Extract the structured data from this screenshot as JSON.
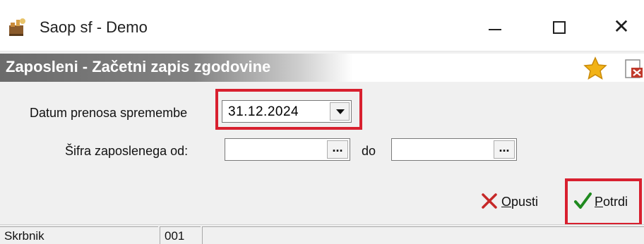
{
  "window": {
    "title": "Saop sf - Demo",
    "controls": {
      "minimize": "minimize",
      "maximize": "maximize",
      "close": "✕"
    }
  },
  "heading": {
    "title": "Zaposleni - Začetni zapis zgodovine",
    "icons": [
      "star-icon",
      "document-delete-icon"
    ]
  },
  "form": {
    "date_label": "Datum prenosa spremembe",
    "date_value": "31.12.2024",
    "code_label": "Šifra zaposlenega od:",
    "code_from": "",
    "to_label": "do",
    "code_to": "",
    "ellipsis": "..."
  },
  "actions": {
    "cancel": {
      "underlined": "O",
      "rest": "pusti",
      "icon": "x-icon"
    },
    "confirm": {
      "underlined": "P",
      "rest": "otrdi",
      "icon": "checkmark-icon"
    }
  },
  "status": {
    "user": "Skrbnik",
    "code": "001",
    "message": ""
  },
  "colors": {
    "highlight": "#d8202f",
    "cancel_icon": "#c62828",
    "confirm_icon": "#1f8a1f",
    "star": "#f2b316"
  }
}
